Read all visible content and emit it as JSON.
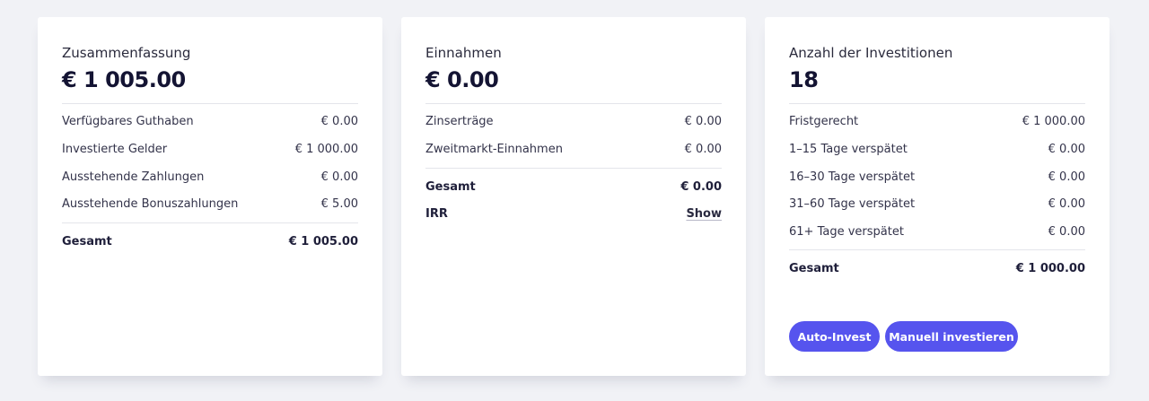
{
  "summary": {
    "title": "Zusammenfassung",
    "amount": "€ 1 005.00",
    "rows": [
      {
        "label": "Verfügbares Guthaben",
        "value": "€ 0.00"
      },
      {
        "label": "Investierte Gelder",
        "value": "€ 1 000.00"
      },
      {
        "label": "Ausstehende Zahlungen",
        "value": "€ 0.00"
      },
      {
        "label": "Ausstehende Bonuszahlungen",
        "value": "€ 5.00"
      }
    ],
    "total": {
      "label": "Gesamt",
      "value": "€ 1 005.00"
    }
  },
  "income": {
    "title": "Einnahmen",
    "amount": "€ 0.00",
    "rows": [
      {
        "label": "Zinserträge",
        "value": "€ 0.00"
      },
      {
        "label": "Zweitmarkt-Einnahmen",
        "value": "€ 0.00"
      }
    ],
    "total": {
      "label": "Gesamt",
      "value": "€ 0.00"
    },
    "irr": {
      "label": "IRR",
      "link": "Show"
    }
  },
  "investments": {
    "title": "Anzahl der Investitionen",
    "amount": "18",
    "rows": [
      {
        "label": "Fristgerecht",
        "value": "€ 1 000.00"
      },
      {
        "label": "1–15 Tage verspätet",
        "value": "€ 0.00"
      },
      {
        "label": "16–30 Tage verspätet",
        "value": "€ 0.00"
      },
      {
        "label": "31–60 Tage verspätet",
        "value": "€ 0.00"
      },
      {
        "label": "61+ Tage verspätet",
        "value": "€ 0.00"
      }
    ],
    "total": {
      "label": "Gesamt",
      "value": "€ 1 000.00"
    },
    "buttons": {
      "auto_invest": "Auto-Invest",
      "manual_invest": "Manuell investieren"
    }
  },
  "colors": {
    "accent": "#5654ee",
    "background": "#f1f2f6",
    "card": "#ffffff"
  }
}
